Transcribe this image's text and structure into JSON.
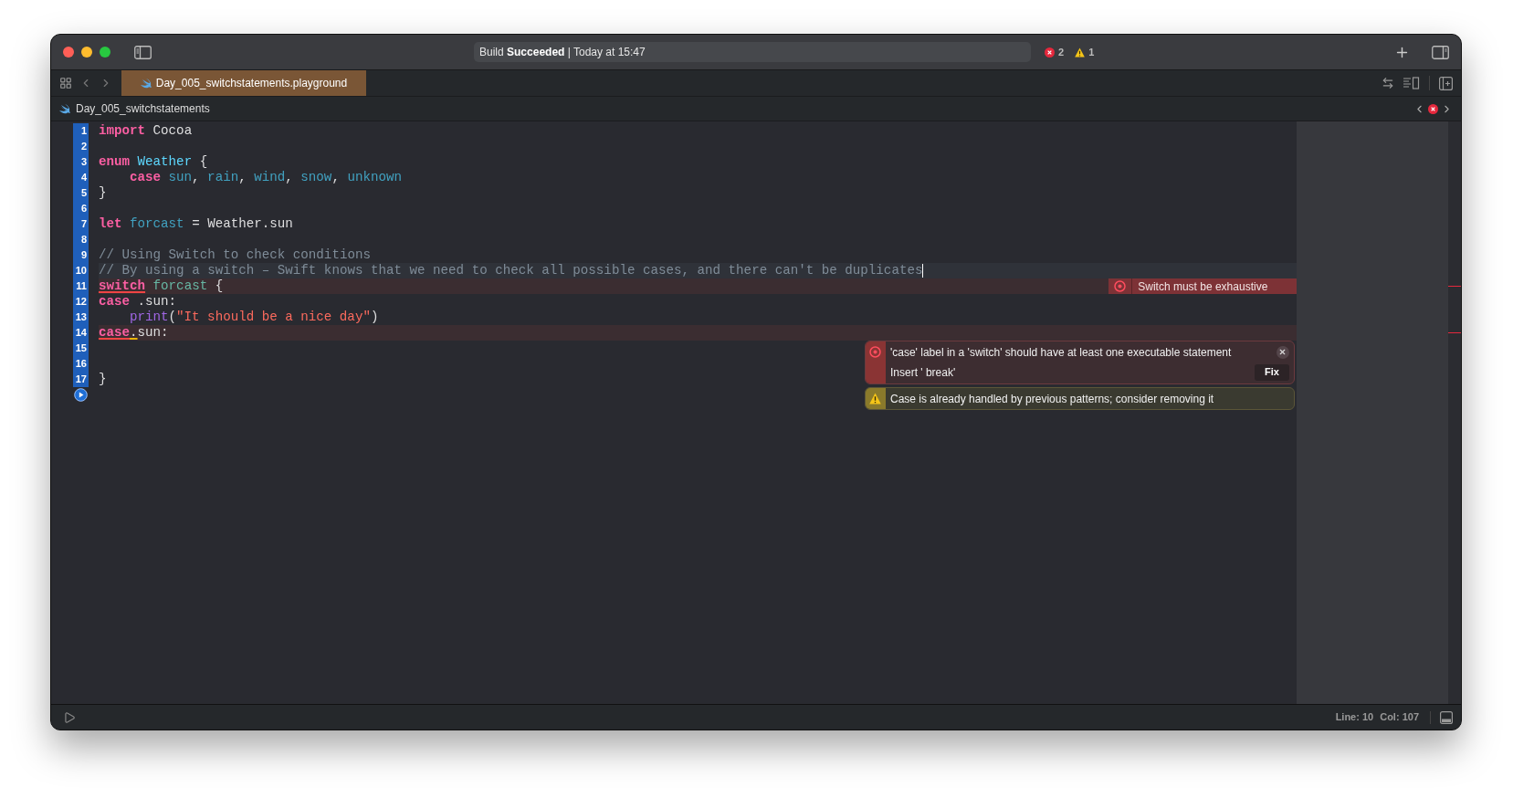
{
  "window": {
    "status": "Build **Succeeded** | Today at 15:47",
    "error_count": "2",
    "warning_count": "1"
  },
  "tabs": [
    {
      "label": "Day_005_switchstatements.playground",
      "selected": true
    }
  ],
  "breadcrumb": "Day_005_switchstatements",
  "editor": {
    "lines": [
      {
        "number": "1",
        "selected": true,
        "current": false,
        "has_error": false,
        "indented": false,
        "tokens": [
          {
            "text": "import",
            "kind": "keyword"
          },
          {
            "text": " Cocoa",
            "kind": "plain"
          }
        ]
      },
      {
        "number": "2",
        "selected": true,
        "current": false,
        "has_error": false,
        "indented": false
      },
      {
        "number": "3",
        "selected": true,
        "current": false,
        "has_error": false,
        "indented": false,
        "tokens": [
          {
            "text": "enum",
            "kind": "keyword"
          },
          {
            "text": " Weather",
            "kind": "type"
          },
          {
            "text": " {",
            "kind": "plain"
          }
        ]
      },
      {
        "number": "4",
        "selected": true,
        "current": false,
        "has_error": false,
        "indented": true,
        "tokens": [
          {
            "text": "case",
            "kind": "keyword"
          },
          {
            "text": " sun",
            "kind": "ident"
          },
          {
            "text": ",",
            "kind": "plain"
          },
          {
            "text": " rain",
            "kind": "ident"
          },
          {
            "text": ",",
            "kind": "plain"
          },
          {
            "text": " wind",
            "kind": "ident"
          },
          {
            "text": ",",
            "kind": "plain"
          },
          {
            "text": " snow",
            "kind": "ident"
          },
          {
            "text": ",",
            "kind": "plain"
          },
          {
            "text": " unknown",
            "kind": "ident"
          }
        ]
      },
      {
        "number": "5",
        "selected": true,
        "current": false,
        "has_error": false,
        "indented": false,
        "tokens": [
          {
            "text": "}",
            "kind": "plain"
          }
        ]
      },
      {
        "number": "6",
        "selected": true,
        "current": false,
        "has_error": false,
        "indented": false
      },
      {
        "number": "7",
        "selected": true,
        "current": false,
        "has_error": false,
        "indented": false,
        "tokens": [
          {
            "text": "let",
            "kind": "keyword"
          },
          {
            "text": " forcast",
            "kind": "ident"
          },
          {
            "text": " = Weather.sun",
            "kind": "plain"
          }
        ]
      },
      {
        "number": "8",
        "selected": true,
        "current": false,
        "has_error": false,
        "indented": false
      },
      {
        "number": "9",
        "selected": true,
        "current": false,
        "has_error": false,
        "indented": false,
        "tokens": [
          {
            "text": "// Using Switch to check conditions",
            "kind": "comment"
          }
        ]
      },
      {
        "number": "10",
        "selected": true,
        "current": true,
        "has_error": false,
        "indented": false,
        "tokens": [
          {
            "text": "// By using a switch – Swift knows that we need to check all possible cases, and there can't be duplicates",
            "kind": "comment"
          }
        ]
      },
      {
        "number": "11",
        "selected": true,
        "current": false,
        "has_error": true,
        "indented": false,
        "annotation": "Switch must be exhaustive",
        "tokens": [
          {
            "text": "switch",
            "kind": "keyword",
            "error_underline": true
          },
          {
            "text": " forcast",
            "kind": "var"
          },
          {
            "text": " {",
            "kind": "plain"
          }
        ]
      },
      {
        "number": "12",
        "selected": true,
        "current": false,
        "has_error": false,
        "indented": false,
        "tokens": [
          {
            "text": "case",
            "kind": "keyword"
          },
          {
            "text": " .sun:",
            "kind": "plain"
          }
        ]
      },
      {
        "number": "13",
        "selected": true,
        "current": false,
        "has_error": false,
        "indented": true,
        "tokens": [
          {
            "text": "print",
            "kind": "func"
          },
          {
            "text": "(",
            "kind": "plain"
          },
          {
            "text": "\"It should be a nice day\"",
            "kind": "string"
          },
          {
            "text": ")",
            "kind": "plain"
          }
        ]
      },
      {
        "number": "14",
        "selected": true,
        "current": false,
        "has_error": true,
        "indented": false,
        "tokens": [
          {
            "text": "case",
            "kind": "keyword",
            "error_underline": true
          },
          {
            "text": ".",
            "kind": "plain",
            "warning_underline": true
          },
          {
            "text": "sun:",
            "kind": "plain"
          }
        ]
      },
      {
        "number": "15",
        "selected": true,
        "current": false,
        "has_error": false,
        "indented": false
      },
      {
        "number": "16",
        "selected": true,
        "current": false,
        "has_error": false,
        "indented": false
      },
      {
        "number": "17",
        "selected": true,
        "current": false,
        "has_error": false,
        "indented": false,
        "tokens": [
          {
            "text": "}",
            "kind": "plain"
          }
        ]
      }
    ],
    "popover": [
      {
        "kind": "error",
        "message": "'case' label in a 'switch' should have at least one executable statement",
        "fix": "Insert ' break'",
        "button": "Fix"
      },
      {
        "kind": "warning",
        "message": "Case is already handled by previous patterns; consider removing it"
      }
    ]
  },
  "status_bar": {
    "line": "Line: 10",
    "col": "Col: 107"
  }
}
